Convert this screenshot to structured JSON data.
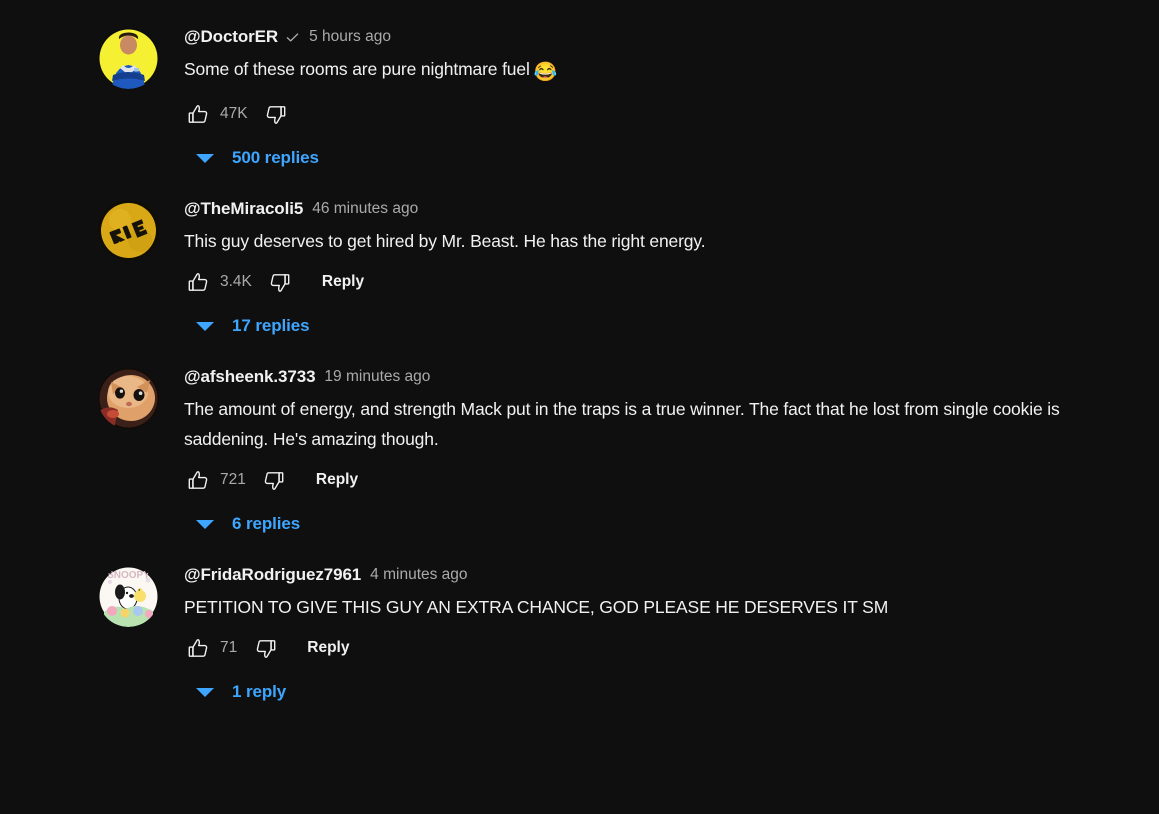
{
  "theme": {
    "background": "#0f0f0f",
    "primary_text": "#f1f1f1",
    "secondary_text": "#aaaaaa",
    "accent_blue": "#3ea6ff"
  },
  "comments": [
    {
      "author": "@DoctorER",
      "verified": true,
      "timestamp": "5 hours ago",
      "text": "Some of these rooms are pure nightmare fuel",
      "emoji": "😂",
      "like_count": "47K",
      "reply_label": "",
      "replies_label": "500 replies",
      "avatar": "doctorer-avatar"
    },
    {
      "author": "@TheMiracoli5",
      "verified": false,
      "timestamp": "46 minutes ago",
      "text": "This guy deserves to get hired by Mr. Beast. He has the right energy.",
      "emoji": "",
      "like_count": "3.4K",
      "reply_label": "Reply",
      "replies_label": "17 replies",
      "avatar": "themiracoli5-avatar"
    },
    {
      "author": "@afsheenk.3733",
      "verified": false,
      "timestamp": "19 minutes ago",
      "text": "The amount of energy, and strength Mack put in the traps is a true winner. The fact that he lost from single cookie is saddening. He's amazing though.",
      "emoji": "",
      "like_count": "721",
      "reply_label": "Reply",
      "replies_label": "6 replies",
      "avatar": "afsheenk-avatar"
    },
    {
      "author": "@FridaRodriguez7961",
      "verified": false,
      "timestamp": "4 minutes ago",
      "text": "PETITION TO GIVE THIS GUY AN EXTRA CHANCE, GOD PLEASE HE DESERVES IT SM",
      "emoji": "",
      "like_count": "71",
      "reply_label": "Reply",
      "replies_label": "1 reply",
      "avatar": "fridarodriguez-avatar"
    }
  ]
}
